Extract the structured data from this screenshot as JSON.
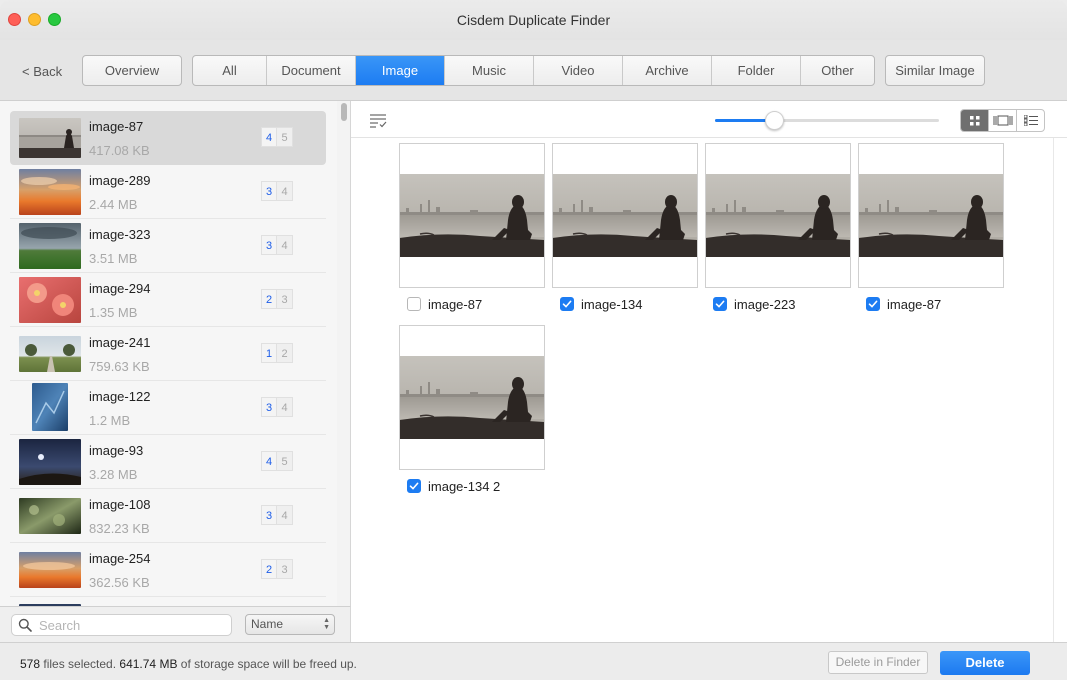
{
  "window": {
    "title": "Cisdem Duplicate Finder"
  },
  "toolbar": {
    "back_label": "< Back",
    "overview_label": "Overview",
    "similar_label": "Similar Image",
    "tabs": [
      {
        "label": "All"
      },
      {
        "label": "Document"
      },
      {
        "label": "Image"
      },
      {
        "label": "Music"
      },
      {
        "label": "Video"
      },
      {
        "label": "Archive"
      },
      {
        "label": "Folder"
      },
      {
        "label": "Other"
      }
    ],
    "active_tab": "Image"
  },
  "sidebar": {
    "items": [
      {
        "name": "image-87",
        "size": "417.08 KB",
        "selected_count": "4",
        "total_count": "5",
        "thumb": "lake-silhouette"
      },
      {
        "name": "image-289",
        "size": "2.44 MB",
        "selected_count": "3",
        "total_count": "4",
        "thumb": "sunset-clouds"
      },
      {
        "name": "image-323",
        "size": "3.51 MB",
        "selected_count": "3",
        "total_count": "4",
        "thumb": "storm-field"
      },
      {
        "name": "image-294",
        "size": "1.35 MB",
        "selected_count": "2",
        "total_count": "3",
        "thumb": "pink-flowers"
      },
      {
        "name": "image-241",
        "size": "759.63 KB",
        "selected_count": "1",
        "total_count": "2",
        "thumb": "tree-road"
      },
      {
        "name": "image-122",
        "size": "1.2 MB",
        "selected_count": "3",
        "total_count": "4",
        "thumb": "blue-ice"
      },
      {
        "name": "image-93",
        "size": "3.28 MB",
        "selected_count": "4",
        "total_count": "5",
        "thumb": "night-moon"
      },
      {
        "name": "image-108",
        "size": "832.23 KB",
        "selected_count": "3",
        "total_count": "4",
        "thumb": "foliage"
      },
      {
        "name": "image-254",
        "size": "362.56 KB",
        "selected_count": "2",
        "total_count": "3",
        "thumb": "sunset-clouds"
      }
    ],
    "search_placeholder": "Search",
    "sort_value": "Name"
  },
  "content": {
    "zoom_level": 0.27,
    "view_mode": "grid",
    "cards": [
      {
        "name": "image-87",
        "checked": false
      },
      {
        "name": "image-134",
        "checked": true
      },
      {
        "name": "image-223",
        "checked": true
      },
      {
        "name": "image-87",
        "checked": true
      },
      {
        "name": "image-134 2",
        "checked": true
      }
    ]
  },
  "status": {
    "count": "578",
    "count_text": " files selected. ",
    "size": "641.74 MB",
    "size_text": " of storage space will be freed up.",
    "delete_in_finder_label": "Delete in Finder",
    "delete_label": "Delete"
  },
  "colors": {
    "accent": "#1d7cf2",
    "badge_selected": "#1d5de8",
    "close": "#fe5f57",
    "minimize": "#febc2e",
    "maximize": "#28c840"
  }
}
